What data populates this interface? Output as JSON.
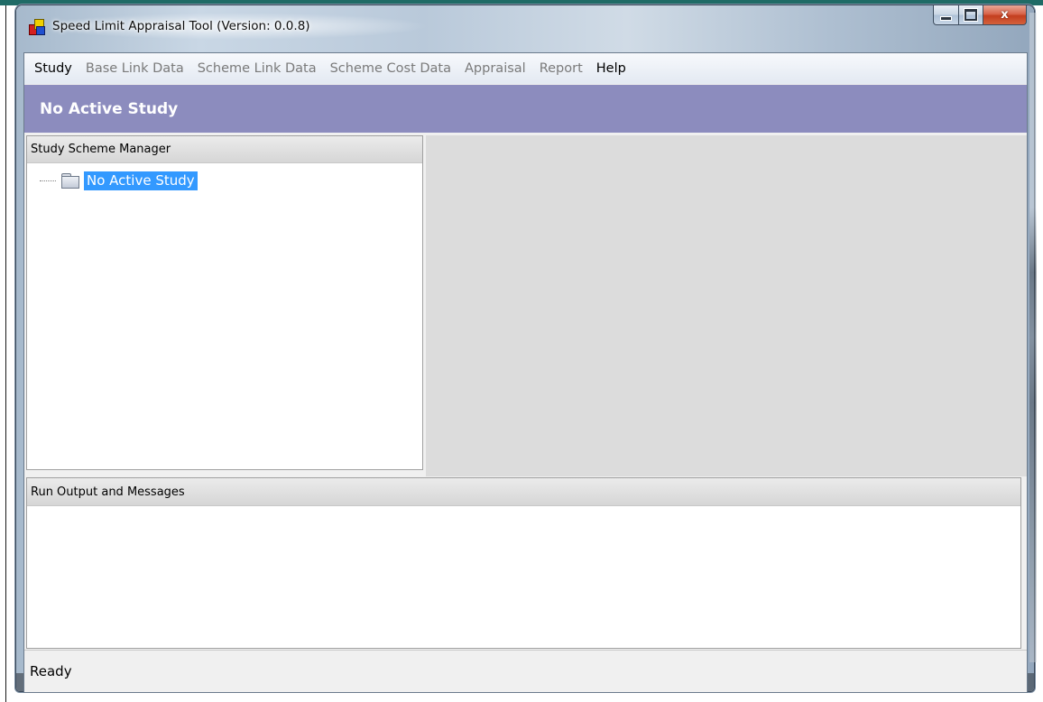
{
  "window": {
    "title": "Speed Limit Appraisal Tool  (Version: 0.0.8)",
    "controls": {
      "minimize": "minimize",
      "maximize": "maximize",
      "close": "x"
    }
  },
  "menu": {
    "items": [
      {
        "label": "Study",
        "enabled": true
      },
      {
        "label": "Base Link Data",
        "enabled": false
      },
      {
        "label": "Scheme Link Data",
        "enabled": false
      },
      {
        "label": "Scheme Cost Data",
        "enabled": false
      },
      {
        "label": "Appraisal",
        "enabled": false
      },
      {
        "label": "Report",
        "enabled": false
      },
      {
        "label": "Help",
        "enabled": true
      }
    ]
  },
  "banner": {
    "text": "No Active Study",
    "color": "#8c8cbe"
  },
  "scheme_manager": {
    "title": "Study Scheme Manager",
    "tree": [
      {
        "label": "No Active Study",
        "icon": "folder-icon",
        "selected": true
      }
    ]
  },
  "output_panel": {
    "title": "Run Output and Messages"
  },
  "status": {
    "text": "Ready"
  },
  "colors": {
    "selection": "#3399ff",
    "banner": "#8c8cbe",
    "close_button": "#c94a2c"
  }
}
